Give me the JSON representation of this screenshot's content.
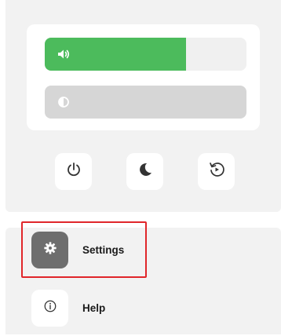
{
  "sliders": {
    "volume": {
      "icon": "speaker-icon",
      "level": 0.7,
      "fill_color": "#4cbb5c"
    },
    "brightness": {
      "icon": "contrast-icon",
      "level": 0.0,
      "track_color": "#d6d6d6"
    }
  },
  "quick_actions": [
    {
      "icon": "power-icon",
      "action": "power"
    },
    {
      "icon": "moon-icon",
      "action": "sleep"
    },
    {
      "icon": "restart-icon",
      "action": "restart"
    }
  ],
  "menu": {
    "settings": {
      "label": "Settings",
      "icon": "gear-icon",
      "highlight_color": "#e0262a"
    },
    "help": {
      "label": "Help",
      "icon": "info-icon"
    }
  }
}
